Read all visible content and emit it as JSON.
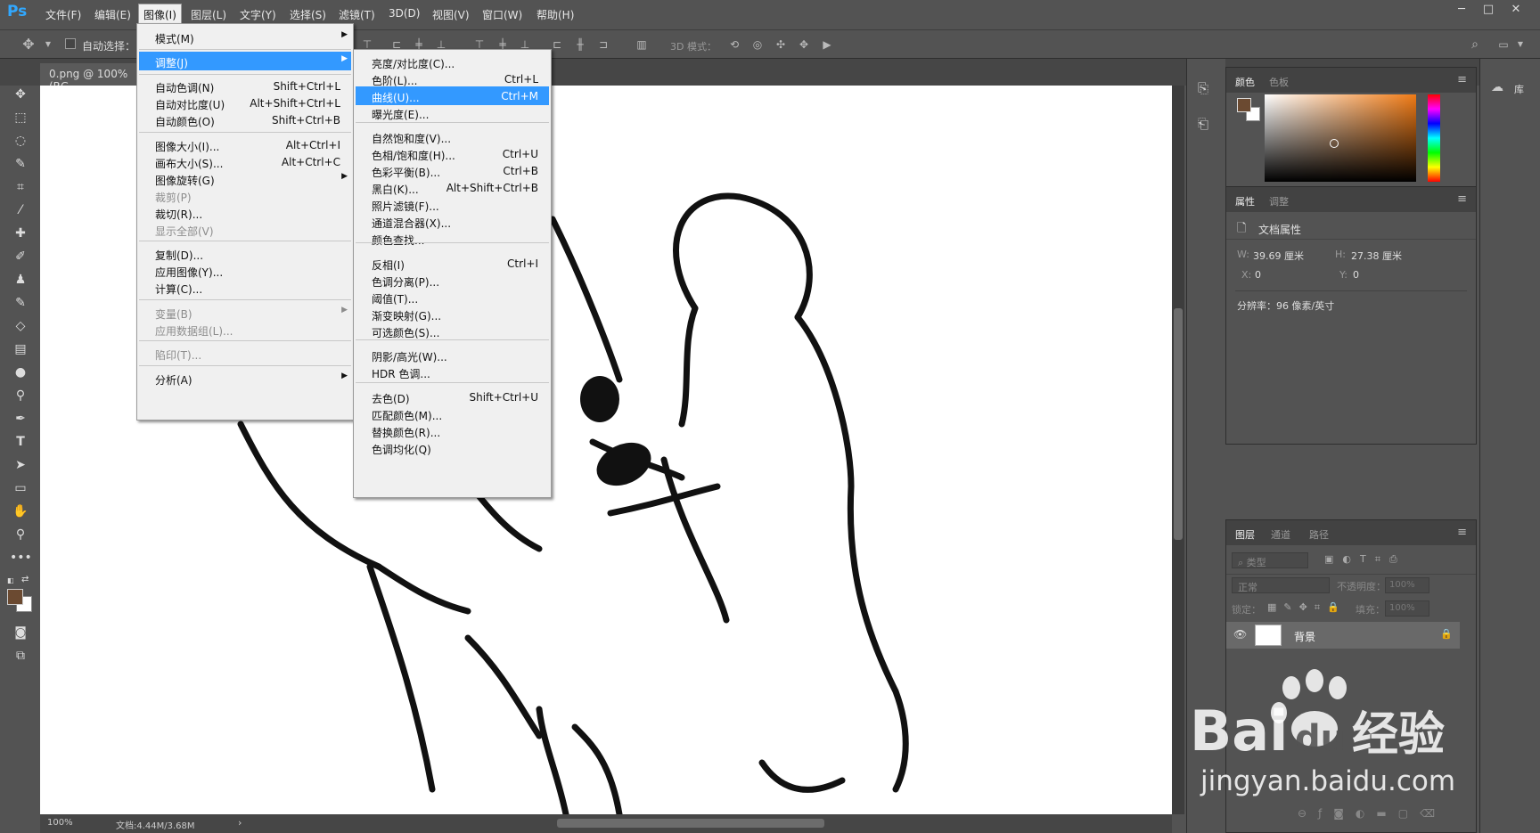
{
  "app": {
    "logo": "Ps"
  },
  "menubar": {
    "items": [
      "文件(F)",
      "编辑(E)",
      "图像(I)",
      "图层(L)",
      "文字(Y)",
      "选择(S)",
      "滤镜(T)",
      "3D(D)",
      "视图(V)",
      "窗口(W)",
      "帮助(H)"
    ],
    "active_index": 2
  },
  "window_controls": {
    "minimize": "─",
    "restore": "□",
    "close": "✕"
  },
  "options": {
    "auto_select_label": "自动选择：",
    "mode_3d_label": "3D 模式："
  },
  "document": {
    "tab_title": "0.png @ 100%(RG"
  },
  "status": {
    "zoom": "100%",
    "doc_size": "文档:4.44M/3.68M",
    "arrow": "›"
  },
  "image_menu": {
    "items": [
      {
        "label": "模式(M)",
        "shortcut": "",
        "submenu": true
      },
      {
        "label": "调整(J)",
        "shortcut": "",
        "submenu": true,
        "highlighted": true
      },
      {
        "label": "自动色调(N)",
        "shortcut": "Shift+Ctrl+L"
      },
      {
        "label": "自动对比度(U)",
        "shortcut": "Alt+Shift+Ctrl+L"
      },
      {
        "label": "自动颜色(O)",
        "shortcut": "Shift+Ctrl+B"
      },
      {
        "label": "图像大小(I)...",
        "shortcut": "Alt+Ctrl+I"
      },
      {
        "label": "画布大小(S)...",
        "shortcut": "Alt+Ctrl+C"
      },
      {
        "label": "图像旋转(G)",
        "shortcut": "",
        "submenu": true
      },
      {
        "label": "裁剪(P)",
        "shortcut": "",
        "disabled": true
      },
      {
        "label": "裁切(R)...",
        "shortcut": ""
      },
      {
        "label": "显示全部(V)",
        "shortcut": "",
        "disabled": true
      },
      {
        "label": "复制(D)...",
        "shortcut": ""
      },
      {
        "label": "应用图像(Y)...",
        "shortcut": ""
      },
      {
        "label": "计算(C)...",
        "shortcut": ""
      },
      {
        "label": "变量(B)",
        "shortcut": "",
        "submenu": true,
        "disabled": true
      },
      {
        "label": "应用数据组(L)...",
        "shortcut": "",
        "disabled": true
      },
      {
        "label": "陷印(T)...",
        "shortcut": "",
        "disabled": true
      },
      {
        "label": "分析(A)",
        "shortcut": "",
        "submenu": true
      }
    ]
  },
  "adjust_menu": {
    "items": [
      {
        "label": "亮度/对比度(C)...",
        "shortcut": ""
      },
      {
        "label": "色阶(L)...",
        "shortcut": "Ctrl+L"
      },
      {
        "label": "曲线(U)...",
        "shortcut": "Ctrl+M",
        "highlighted": true
      },
      {
        "label": "曝光度(E)...",
        "shortcut": ""
      },
      {
        "label": "自然饱和度(V)...",
        "shortcut": ""
      },
      {
        "label": "色相/饱和度(H)...",
        "shortcut": "Ctrl+U"
      },
      {
        "label": "色彩平衡(B)...",
        "shortcut": "Ctrl+B"
      },
      {
        "label": "黑白(K)...",
        "shortcut": "Alt+Shift+Ctrl+B"
      },
      {
        "label": "照片滤镜(F)...",
        "shortcut": ""
      },
      {
        "label": "通道混合器(X)...",
        "shortcut": ""
      },
      {
        "label": "颜色查找...",
        "shortcut": ""
      },
      {
        "label": "反相(I)",
        "shortcut": "Ctrl+I"
      },
      {
        "label": "色调分离(P)...",
        "shortcut": ""
      },
      {
        "label": "阈值(T)...",
        "shortcut": ""
      },
      {
        "label": "渐变映射(G)...",
        "shortcut": ""
      },
      {
        "label": "可选颜色(S)...",
        "shortcut": ""
      },
      {
        "label": "阴影/高光(W)...",
        "shortcut": ""
      },
      {
        "label": "HDR 色调...",
        "shortcut": ""
      },
      {
        "label": "去色(D)",
        "shortcut": "Shift+Ctrl+U"
      },
      {
        "label": "匹配颜色(M)...",
        "shortcut": ""
      },
      {
        "label": "替换颜色(R)...",
        "shortcut": ""
      },
      {
        "label": "色调均化(Q)",
        "shortcut": ""
      }
    ]
  },
  "color_panel": {
    "tabs": [
      "颜色",
      "色板"
    ],
    "foreground": "#6b4a31",
    "background": "#ffffff",
    "hue_color": "#f07b16"
  },
  "properties_panel": {
    "tabs": [
      "属性",
      "调整"
    ],
    "title": "文档属性",
    "w_label": "W:",
    "w_value": "39.69 厘米",
    "h_label": "H:",
    "h_value": "27.38 厘米",
    "x_label": "X:",
    "x_value": "0",
    "y_label": "Y:",
    "y_value": "0",
    "resolution": "分辨率：96 像素/英寸"
  },
  "layers_panel": {
    "tabs": [
      "图层",
      "通道",
      "路径"
    ],
    "filter_placeholder": "类型",
    "blend_mode": "正常",
    "opacity_label": "不透明度：",
    "opacity_value": "100%",
    "lock_label": "锁定：",
    "fill_label": "填充：",
    "fill_value": "100%",
    "layer_name": "背景"
  },
  "library_label": "库",
  "watermark": {
    "brand": "Bai",
    "brand2": "du",
    "cn": "经验",
    "url": "jingyan.baidu.com"
  }
}
